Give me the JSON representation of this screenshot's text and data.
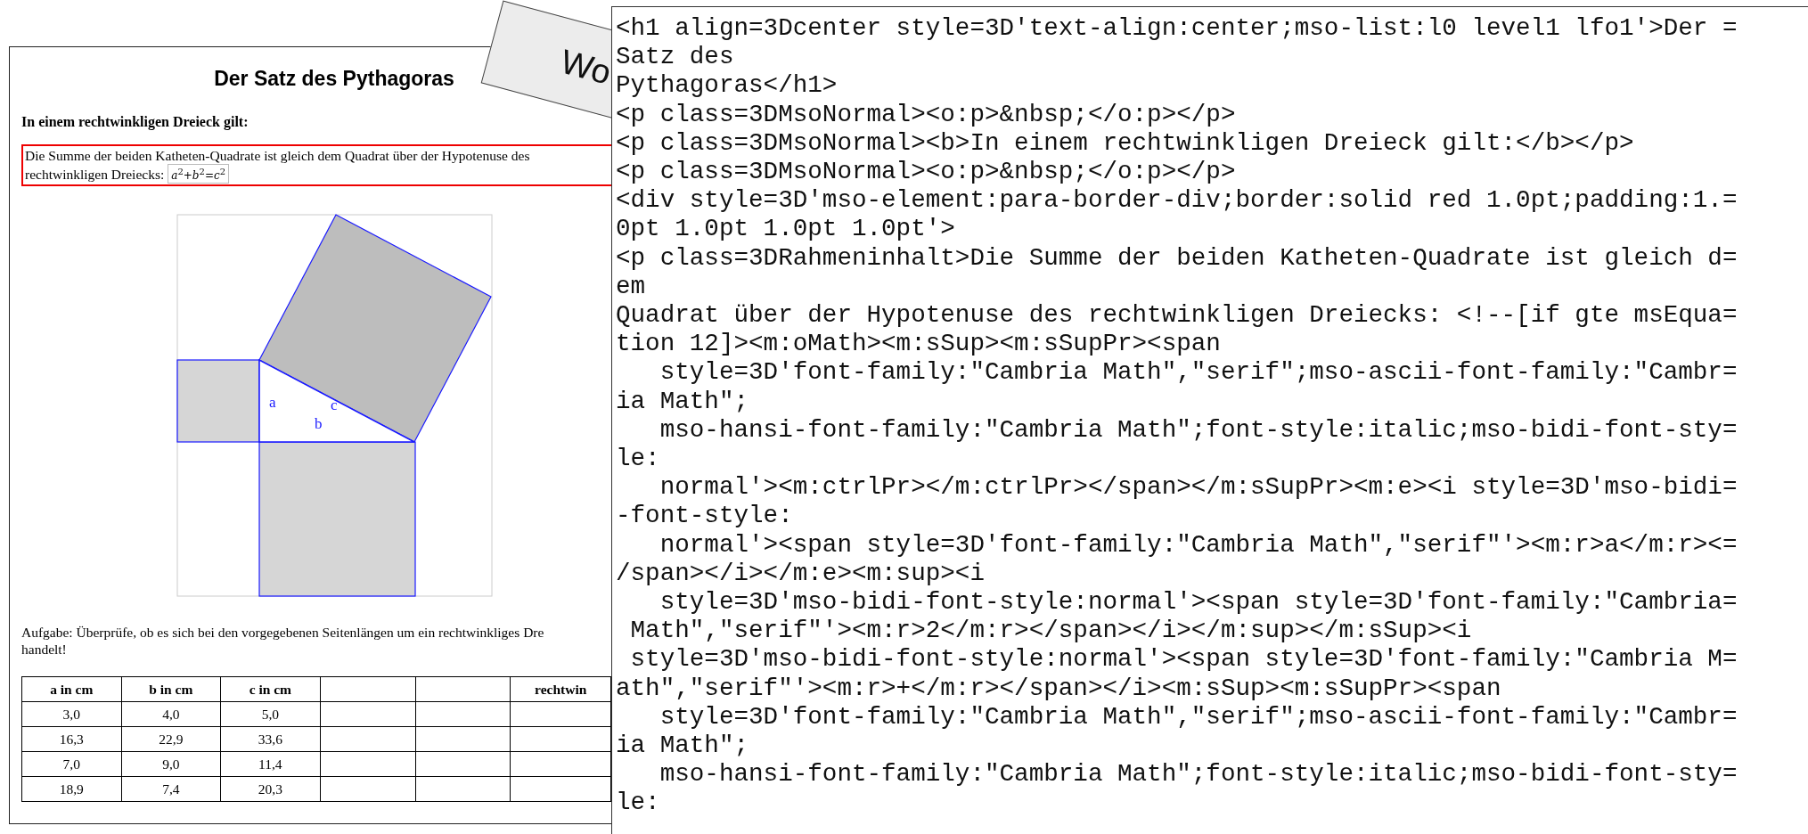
{
  "document": {
    "title": "Der Satz des Pythagoras",
    "intro": "In einem rechtwinkligen Dreieck gilt:",
    "framed_lines": [
      "Die Summe der beiden Katheten-Quadrate ist gleich dem Quadrat über der Hypotenuse des",
      "rechtwinkligen Dreiecks:"
    ],
    "formula": "*a*$^{2}$+*b*$^{2}$=*c*$^{2}$",
    "diagram_labels": [
      "a",
      "b",
      "c"
    ],
    "task_lines": [
      "Aufgabe: Überprüfe, ob es sich bei den vorgegebenen Seitenlängen um ein rechtwinkliges Dre",
      "handelt!"
    ],
    "table": {
      "columns": [
        "a in cm",
        "b in cm",
        "c in cm",
        "",
        "",
        "rechtwin"
      ],
      "rows": [
        [
          "3,0",
          "4,0",
          "5,0",
          "",
          "",
          ""
        ],
        [
          "16,3",
          "22,9",
          "33,6",
          "",
          "",
          ""
        ],
        [
          "7,0",
          "9,0",
          "11,4",
          "",
          "",
          ""
        ],
        [
          "18,9",
          "7,4",
          "20,3",
          "",
          "",
          ""
        ]
      ]
    }
  },
  "label_card": {
    "text": "Wo"
  },
  "source_view": {
    "lines": [
      "<h1 align=3Dcenter style=3D'text-align:center;mso-list:l0 level1 lfo1'>Der =",
      "Satz des",
      "Pythagoras</h1>",
      "<p class=3DMsoNormal><o:p>&nbsp;</o:p></p>",
      "<p class=3DMsoNormal><b>In einem rechtwinkligen Dreieck gilt:</b></p>",
      "<p class=3DMsoNormal><o:p>&nbsp;</o:p></p>",
      "<div style=3D'mso-element:para-border-div;border:solid red 1.0pt;padding:1.=",
      "0pt 1.0pt 1.0pt 1.0pt'>",
      "<p class=3DRahmeninhalt>Die Summe der beiden Katheten-Quadrate ist gleich d=",
      "em",
      "Quadrat über der Hypotenuse des rechtwinkligen Dreiecks: <!--[if gte msEqua=",
      "tion 12]><m:oMath><m:sSup><m:sSupPr><span",
      "   style=3D'font-family:\"Cambria Math\",\"serif\";mso-ascii-font-family:\"Cambr=",
      "ia Math\";",
      "   mso-hansi-font-family:\"Cambria Math\";font-style:italic;mso-bidi-font-sty=",
      "le:",
      "   normal'><m:ctrlPr></m:ctrlPr></span></m:sSupPr><m:e><i style=3D'mso-bidi=",
      "-font-style:",
      "   normal'><span style=3D'font-family:\"Cambria Math\",\"serif\"'><m:r>a</m:r><=",
      "/span></i></m:e><m:sup><i",
      "   style=3D'mso-bidi-font-style:normal'><span style=3D'font-family:\"Cambria=",
      " Math\",\"serif\"'><m:r>2</m:r></span></i></m:sup></m:sSup><i",
      " style=3D'mso-bidi-font-style:normal'><span style=3D'font-family:\"Cambria M=",
      "ath\",\"serif\"'><m:r>+</m:r></span></i><m:sSup><m:sSupPr><span",
      "   style=3D'font-family:\"Cambria Math\",\"serif\";mso-ascii-font-family:\"Cambr=",
      "ia Math\";",
      "   mso-hansi-font-family:\"Cambria Math\";font-style:italic;mso-bidi-font-sty=",
      "le:"
    ]
  }
}
